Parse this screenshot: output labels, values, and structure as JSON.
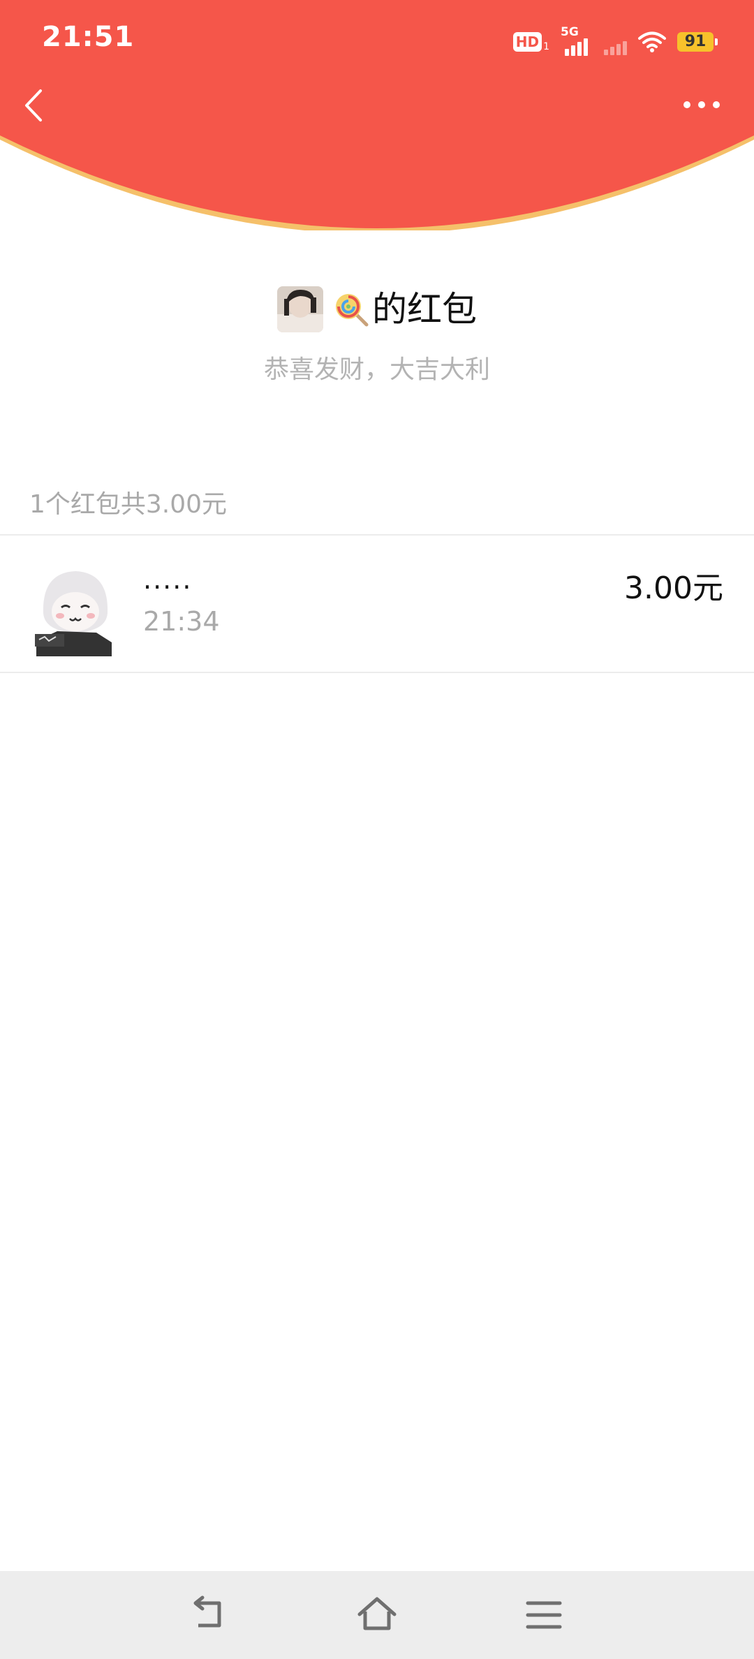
{
  "status_bar": {
    "time": "21:51",
    "hd_label": "HD",
    "hd_sub": "1",
    "network_label": "5G",
    "battery_level": "91"
  },
  "header": {
    "bg_color": "#f5564a",
    "arc_border_color": "#f5c06a",
    "back_icon": "chevron-left-icon",
    "more_icon": "more-dots-icon"
  },
  "sender": {
    "emoji": "🍭",
    "title": "的红包",
    "blessing": "恭喜发财，大吉大利"
  },
  "summary": {
    "text": "1个红包共3.00元"
  },
  "receivers": [
    {
      "name": ".....",
      "time": "21:34",
      "amount": "3.00元"
    }
  ],
  "system_nav": {
    "back_icon": "nav-back-icon",
    "home_icon": "nav-home-icon",
    "menu_icon": "nav-menu-icon"
  }
}
